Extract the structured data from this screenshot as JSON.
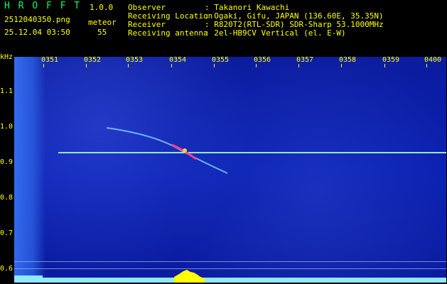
{
  "app": {
    "name": "H R O F F T",
    "version": "1.0.0"
  },
  "file": {
    "name": "2512040350.png",
    "datetime": "25.12.04 03:50"
  },
  "detection": {
    "label": "meteor",
    "count": "55"
  },
  "info": [
    {
      "label": "Observer",
      "value": ": Takanori Kawachi"
    },
    {
      "label": "Receiving Location",
      "value": ": Ogaki, Gifu, JAPAN (136.60E, 35.35N)"
    },
    {
      "label": "Receiver",
      "value": ": R820T2(RTL-SDR) SDR-Sharp 53.1000MHz"
    },
    {
      "label": "Receiving antenna",
      "value": ": 2el-HB9CV Vertical (el. E-W)"
    }
  ],
  "axis": {
    "y_unit": "kHz",
    "y_ticks": [
      "1.1",
      "1.0",
      "0.9",
      "0.8",
      "0.7",
      "0.6"
    ],
    "x_ticks": [
      "0351",
      "0352",
      "0353",
      "0354",
      "0355",
      "0356",
      "0357",
      "0358",
      "0359",
      "0400"
    ]
  },
  "colors": {
    "label": "#ffff00",
    "accent": "#00ff66",
    "spectrogram_bg": "#0a1fb0",
    "carrier": "#8fe8ff",
    "meteor_head": "#ff4080"
  }
}
